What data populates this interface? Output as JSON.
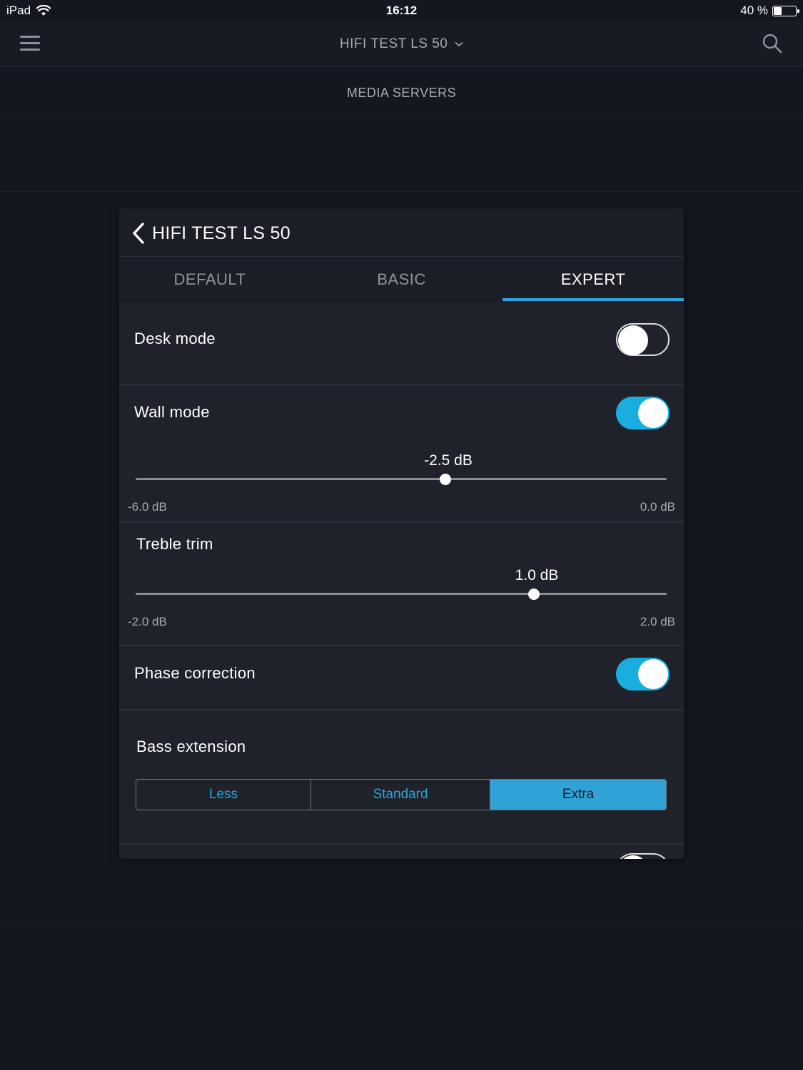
{
  "status_bar": {
    "device": "iPad",
    "time": "16:12",
    "battery_text": "40 %",
    "battery_level": 0.4
  },
  "nav": {
    "title": "HIFI TEST LS 50",
    "menu_icon": "hamburger-icon",
    "search_icon": "search-icon"
  },
  "sub_header": {
    "title": "MEDIA SERVERS"
  },
  "panel": {
    "back_title": "HIFI TEST LS 50",
    "tabs": [
      {
        "label": "DEFAULT",
        "active": false
      },
      {
        "label": "BASIC",
        "active": false
      },
      {
        "label": "EXPERT",
        "active": true
      }
    ],
    "desk_mode": {
      "label": "Desk mode",
      "on": false
    },
    "wall_mode": {
      "label": "Wall mode",
      "on": true,
      "slider": {
        "value_text": "-2.5 dB",
        "value": -2.5,
        "min": -6.0,
        "max": 0.0,
        "min_text": "-6.0 dB",
        "max_text": "0.0 dB"
      }
    },
    "treble_trim": {
      "label": "Treble trim",
      "slider": {
        "value_text": "1.0 dB",
        "value": 1.0,
        "min": -2.0,
        "max": 2.0,
        "min_text": "-2.0 dB",
        "max_text": "2.0 dB"
      }
    },
    "phase_correction": {
      "label": "Phase correction",
      "on": true
    },
    "bass_extension": {
      "label": "Bass extension",
      "options": [
        "Less",
        "Standard",
        "Extra"
      ],
      "selected": "Extra"
    }
  },
  "colors": {
    "accent": "#2fa3d8",
    "toggle_on": "#1aaee0",
    "background": "#14171f",
    "panel": "#1f222b"
  }
}
